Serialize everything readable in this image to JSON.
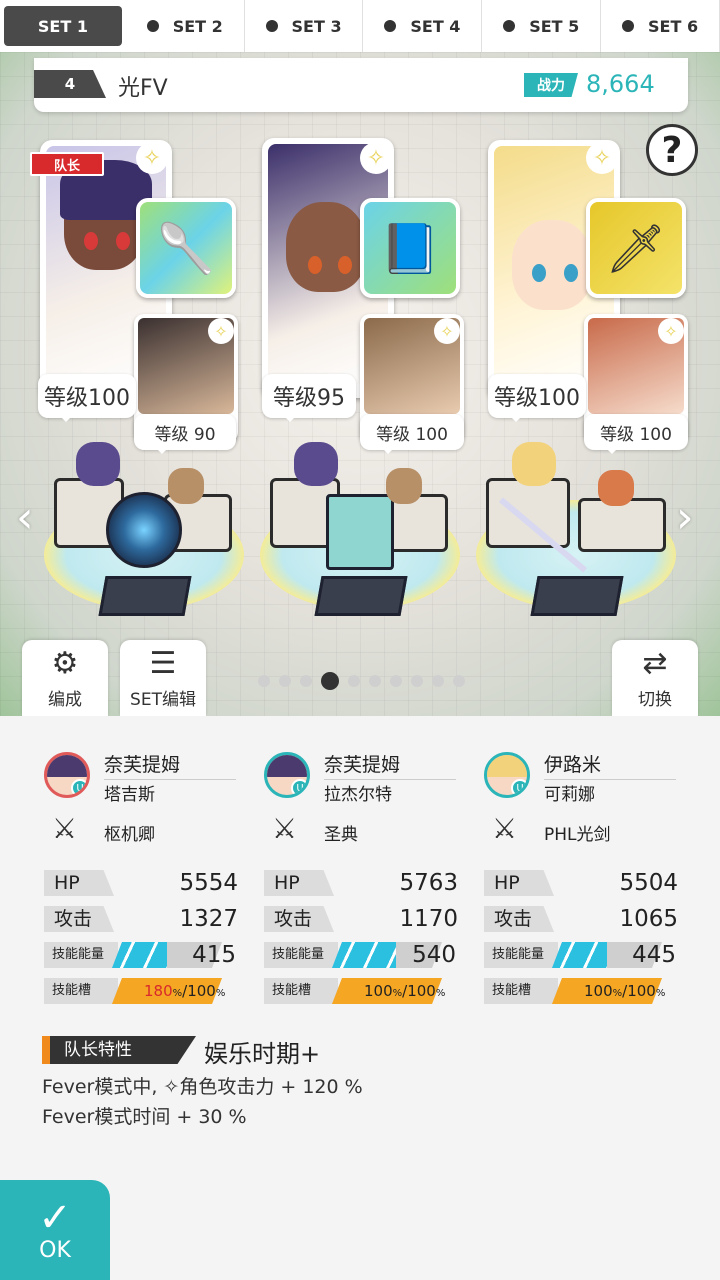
{
  "tabs": [
    {
      "label": "SET 1",
      "active": true
    },
    {
      "label": "SET 2",
      "active": false
    },
    {
      "label": "SET 3",
      "active": false
    },
    {
      "label": "SET 4",
      "active": false
    },
    {
      "label": "SET 5",
      "active": false
    },
    {
      "label": "SET 6",
      "active": false
    }
  ],
  "header": {
    "number": "4",
    "name": "光FV",
    "power_label": "战力",
    "power_value": "8,664"
  },
  "leader_badge": "队长",
  "help_icon": "?",
  "formation": [
    {
      "main_level": "等级100",
      "sub_level": "等级 90"
    },
    {
      "main_level": "等级95",
      "sub_level": "等级 100"
    },
    {
      "main_level": "等级100",
      "sub_level": "等级 100"
    }
  ],
  "buttons": {
    "formation": "编成",
    "set_edit": "SET编辑",
    "switch": "切换",
    "ok": "OK"
  },
  "pager": {
    "count": 10,
    "active_index": 3
  },
  "stats_labels": {
    "hp": "HP",
    "atk": "攻击",
    "skill_energy": "技能能量",
    "skill_slot": "技能槽"
  },
  "characters": [
    {
      "name": "奈芙提姆",
      "partner": "塔吉斯",
      "weapon": "枢机卿",
      "hp": "5554",
      "atk": "1327",
      "energy": "415",
      "energy_fill": 0.5,
      "slot_a": "180",
      "slot_b": "100",
      "slot_fill": 1.0,
      "slot_red": true
    },
    {
      "name": "奈芙提姆",
      "partner": "拉杰尔特",
      "weapon": "圣典",
      "hp": "5763",
      "atk": "1170",
      "energy": "540",
      "energy_fill": 0.58,
      "slot_a": "100",
      "slot_b": "100",
      "slot_fill": 1.0,
      "slot_red": false
    },
    {
      "name": "伊路米",
      "partner": "可莉娜",
      "weapon": "PHL光剑",
      "hp": "5504",
      "atk": "1065",
      "energy": "445",
      "energy_fill": 0.5,
      "slot_a": "100",
      "slot_b": "100",
      "slot_fill": 1.0,
      "slot_red": false
    }
  ],
  "leader_skill": {
    "label": "队长特性",
    "name": "娱乐时期+",
    "line1": "Fever模式中, ✧角色攻击力 + 120 %",
    "line2": "Fever模式时间 + 30 %"
  },
  "colors": {
    "accent": "#2bb5b8",
    "leader_red": "#d8292c",
    "energy": "#2bbfe0",
    "slot": "#f5a623"
  }
}
